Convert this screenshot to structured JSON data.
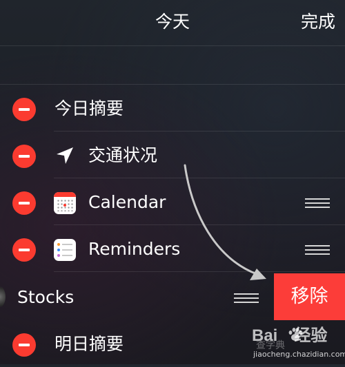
{
  "header": {
    "title": "今天",
    "done_label": "完成"
  },
  "rows": [
    {
      "label": "今日摘要",
      "icon": "",
      "removable": true,
      "draggable": false
    },
    {
      "label": "交通状况",
      "icon": "location-arrow-icon",
      "removable": true,
      "draggable": false
    },
    {
      "label": "Calendar",
      "icon": "calendar-icon",
      "removable": true,
      "draggable": true
    },
    {
      "label": "Reminders",
      "icon": "reminders-icon",
      "removable": true,
      "draggable": true
    },
    {
      "label": "Stocks",
      "icon": "stocks-icon",
      "removable": false,
      "draggable": true,
      "swiped": true
    },
    {
      "label": "明日摘要",
      "icon": "",
      "removable": true,
      "draggable": false
    }
  ],
  "remove_button": {
    "label": "移除"
  },
  "watermark": {
    "brand": "Bai",
    "brand_suffix": "经验",
    "ghost_text": "查字典",
    "site": "jiaocheng.chazidian.com"
  },
  "colors": {
    "destructive_red": "#fb3b30",
    "text": "#ffffff",
    "background": "#1e2229"
  }
}
